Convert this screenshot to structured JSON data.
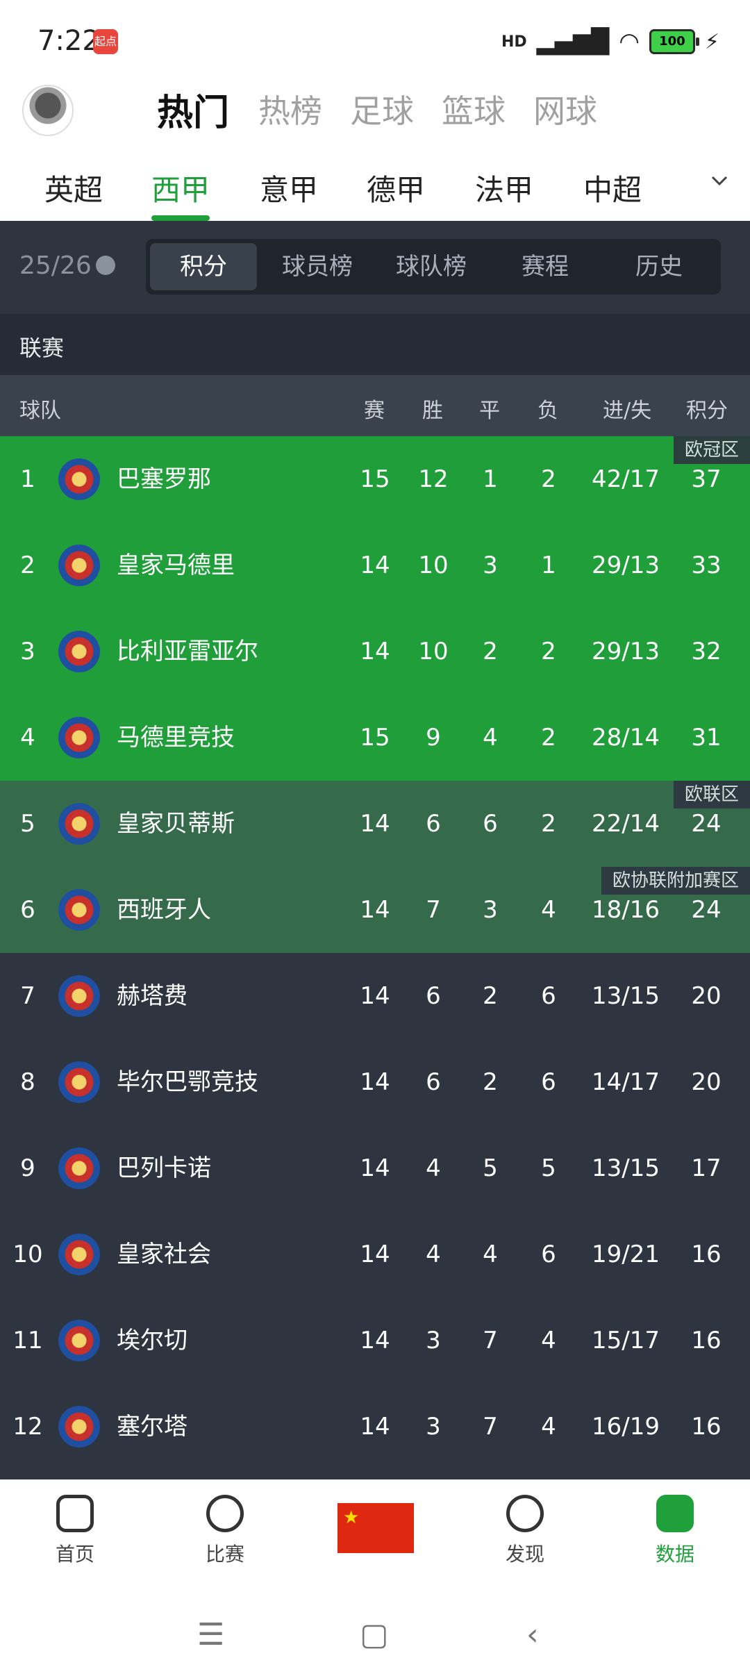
{
  "status": {
    "time": "7:22",
    "app_badge": "起点",
    "network": "HD",
    "battery": "100"
  },
  "top_tabs": [
    "热门",
    "热榜",
    "足球",
    "篮球",
    "网球"
  ],
  "leagues": [
    "英超",
    "西甲",
    "意甲",
    "德甲",
    "法甲",
    "中超"
  ],
  "season": "25/26",
  "segments": [
    "积分",
    "球员榜",
    "球队榜",
    "赛程",
    "历史"
  ],
  "section_title": "联赛",
  "headers": {
    "team": "球队",
    "played": "赛",
    "won": "胜",
    "draw": "平",
    "lost": "负",
    "goals": "进/失",
    "points": "积分"
  },
  "zones": {
    "ucl": "欧冠区",
    "uel": "欧联区",
    "uecl": "欧协联附加赛区"
  },
  "rows": [
    {
      "rank": "1",
      "team": "巴塞罗那",
      "played": "15",
      "won": "12",
      "draw": "1",
      "lost": "2",
      "goals": "42/17",
      "points": "37"
    },
    {
      "rank": "2",
      "team": "皇家马德里",
      "played": "14",
      "won": "10",
      "draw": "3",
      "lost": "1",
      "goals": "29/13",
      "points": "33"
    },
    {
      "rank": "3",
      "team": "比利亚雷亚尔",
      "played": "14",
      "won": "10",
      "draw": "2",
      "lost": "2",
      "goals": "29/13",
      "points": "32"
    },
    {
      "rank": "4",
      "team": "马德里竞技",
      "played": "15",
      "won": "9",
      "draw": "4",
      "lost": "2",
      "goals": "28/14",
      "points": "31"
    },
    {
      "rank": "5",
      "team": "皇家贝蒂斯",
      "played": "14",
      "won": "6",
      "draw": "6",
      "lost": "2",
      "goals": "22/14",
      "points": "24"
    },
    {
      "rank": "6",
      "team": "西班牙人",
      "played": "14",
      "won": "7",
      "draw": "3",
      "lost": "4",
      "goals": "18/16",
      "points": "24"
    },
    {
      "rank": "7",
      "team": "赫塔费",
      "played": "14",
      "won": "6",
      "draw": "2",
      "lost": "6",
      "goals": "13/15",
      "points": "20"
    },
    {
      "rank": "8",
      "team": "毕尔巴鄂竞技",
      "played": "14",
      "won": "6",
      "draw": "2",
      "lost": "6",
      "goals": "14/17",
      "points": "20"
    },
    {
      "rank": "9",
      "team": "巴列卡诺",
      "played": "14",
      "won": "4",
      "draw": "5",
      "lost": "5",
      "goals": "13/15",
      "points": "17"
    },
    {
      "rank": "10",
      "team": "皇家社会",
      "played": "14",
      "won": "4",
      "draw": "4",
      "lost": "6",
      "goals": "19/21",
      "points": "16"
    },
    {
      "rank": "11",
      "team": "埃尔切",
      "played": "14",
      "won": "3",
      "draw": "7",
      "lost": "4",
      "goals": "15/17",
      "points": "16"
    },
    {
      "rank": "12",
      "team": "塞尔塔",
      "played": "14",
      "won": "3",
      "draw": "7",
      "lost": "4",
      "goals": "16/19",
      "points": "16"
    }
  ],
  "bottom_nav": [
    "首页",
    "比赛",
    "发现",
    "数据"
  ],
  "colors": {
    "ucl_zone": "#1f9e3a",
    "europa_zone": "#356b4b",
    "normal_row": "#2e3540",
    "accent": "#1fa03a"
  }
}
